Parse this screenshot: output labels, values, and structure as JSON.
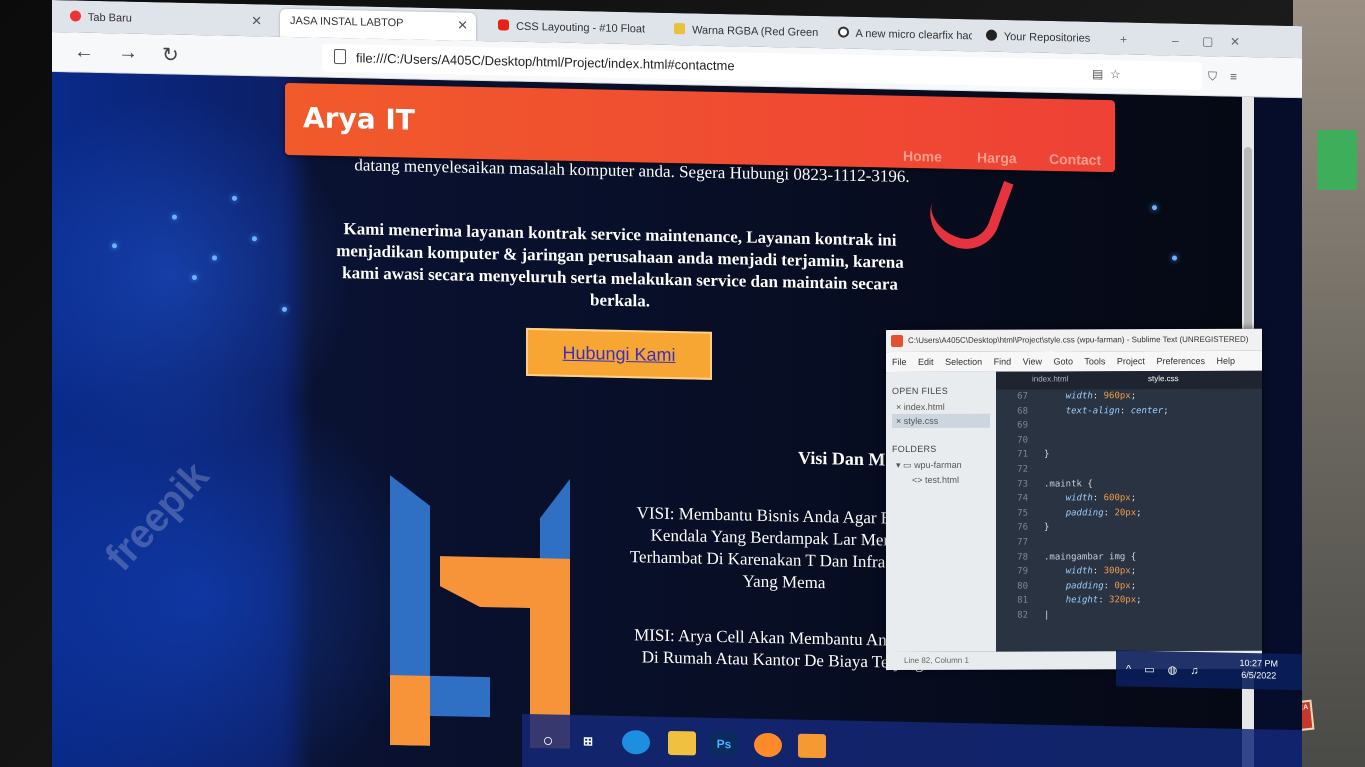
{
  "browser": {
    "tabs": [
      {
        "label": "Tab Baru"
      },
      {
        "label": "JASA INSTAL LABTOP"
      },
      {
        "label": "CSS Layouting - #10 Float"
      },
      {
        "label": "Warna RGBA (Red Green"
      },
      {
        "label": "A new micro clearfix hac"
      },
      {
        "label": "Your Repositories"
      }
    ],
    "url": "file:///C:/Users/A405C/Desktop/html/Project/index.html#contactme"
  },
  "site": {
    "brand": "Arya IT",
    "nav": [
      "Home",
      "Harga",
      "Contact"
    ],
    "intro": "datang menyelesaikan masalah komputer anda. Segera Hubungi 0823-1112-3196.",
    "kontrak": "Kami menerima layanan kontrak service maintenance, Layanan kontrak ini menjadikan komputer & jaringan perusahaan anda menjadi terjamin, karena kami awasi secara menyeluruh serta melakukan service dan maintain secara berkala.",
    "cta": "Hubungi Kami",
    "visi_title": "Visi Dan M",
    "visi": "VISI: Membantu Bisnis Anda Agar Be Ada Kendala Yang Berdampak Lar Menjadi Terhambat Di Karenakan T Dan Infrastruktur Yang Mema",
    "misi": "MISI: Arya Cell Akan Membantu An Komputer Di Rumah Atau Kantor De Biaya Terjangkau.",
    "watermark": "freepik"
  },
  "editor": {
    "title": "C:\\Users\\A405C\\Desktop\\html\\Project\\style.css (wpu-farman) - Sublime Text (UNREGISTERED)",
    "menu": [
      "File",
      "Edit",
      "Selection",
      "Find",
      "View",
      "Goto",
      "Tools",
      "Project",
      "Preferences",
      "Help"
    ],
    "open_files_header": "OPEN FILES",
    "open_files": [
      "index.html",
      "style.css"
    ],
    "folders_header": "FOLDERS",
    "folder": "wpu-farman",
    "folder_file": "test.html",
    "tabs": [
      "index.html",
      "style.css"
    ],
    "line_numbers": [
      "67",
      "68",
      "69",
      "70",
      "71",
      "72",
      "73",
      "74",
      "75",
      "76",
      "77",
      "78",
      "79",
      "80",
      "81",
      "82"
    ],
    "status": "Line 82, Column 1"
  },
  "tray": {
    "time": "10:27 PM",
    "date": "6/5/2022"
  }
}
